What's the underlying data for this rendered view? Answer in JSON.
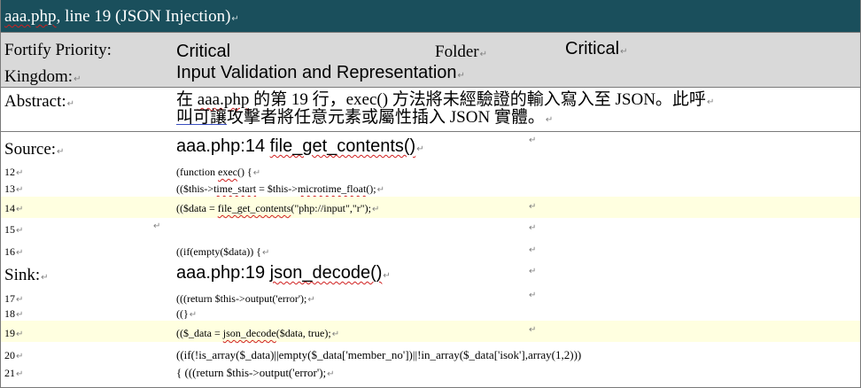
{
  "title": {
    "file": "aaa.php",
    "rest": ", line 19 (JSON Injection)"
  },
  "paragraph_mark": "↵",
  "header": {
    "priority_label": "Fortify Priority:",
    "priority_value": "Critical",
    "folder_label": "Folder",
    "folder_value": "Critical",
    "kingdom_label": "Kingdom:",
    "kingdom_value": "Input Validation and Representation"
  },
  "abstract": {
    "label": "Abstract:",
    "line1_pre": "在 ",
    "line1_file": "aaa.php",
    "line1_post": " 的第 19 行，exec() 方法將未經驗證的輸入寫入至 JSON。此呼",
    "line2_a": "叫可讓",
    "line2_b": "攻擊者將任意元素或屬性插入 JSON 實體。"
  },
  "source": {
    "label": "Source:",
    "location": "aaa.php:14 ",
    "function": "file_get_contents()",
    "lines": [
      {
        "num": "12",
        "pre": "(function ",
        "fn": "exec",
        "post": "() {"
      },
      {
        "num": "13",
        "pre": "(($this->",
        "fn": "time_start",
        "mid": " = $this->",
        "fn2": "microtime_float",
        "post": "();"
      },
      {
        "num": "14",
        "pre": "(($data = ",
        "fn": "file_get_contents",
        "post": "(\"php://input\",\"r\");"
      },
      {
        "num": "15",
        "text": ""
      },
      {
        "num": "16",
        "text": "((if(empty($data)) {"
      }
    ]
  },
  "sink": {
    "label": "Sink:",
    "location": "aaa.php:19 ",
    "function": "json_decode()",
    "lines": [
      {
        "num": "17",
        "text": "(((return $this->output('error');"
      },
      {
        "num": "18",
        "text": "((}"
      },
      {
        "num": "19",
        "pre": "(($_data = ",
        "fn": "json_decode",
        "post": "($data, true);"
      },
      {
        "num": "20",
        "text": "((if(!is_array($_data)||empty($_data['member_no'])||!in_array($_data['isok'],array(1,2)))"
      },
      {
        "num": "21",
        "text": "{ (((return $this->output('error');"
      }
    ]
  },
  "colors": {
    "title_bg": "#1a4f5c",
    "header_bg": "#d9d9d9",
    "highlight": "#ffffe0",
    "spell_underline": "#d02020"
  }
}
